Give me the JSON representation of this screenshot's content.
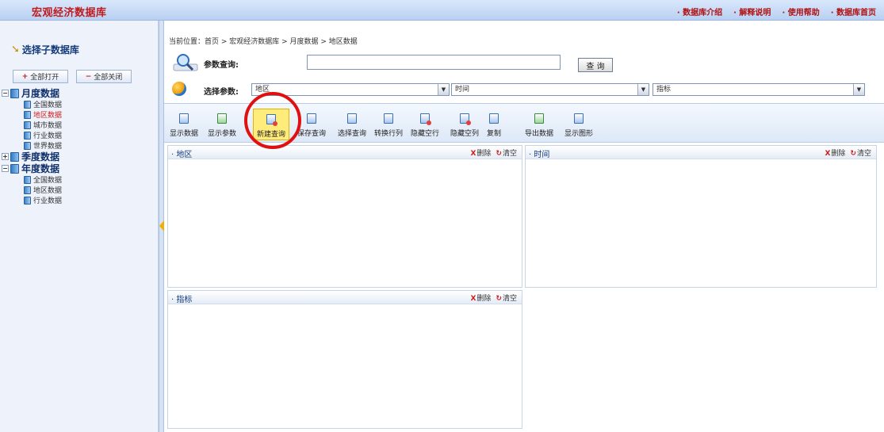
{
  "header": {
    "app_title": "宏观经济数据库",
    "links": [
      "· 数据库介绍",
      "· 解释说明",
      "· 使用帮助",
      "· 数据库首页"
    ]
  },
  "sidebar": {
    "title": "选择子数据库",
    "expand_all": "全部打开",
    "collapse_all": "全部关闭",
    "tree": [
      {
        "label": "月度数据",
        "children": [
          "全国数据",
          "地区数据",
          "城市数据",
          "行业数据",
          "世界数据"
        ]
      },
      {
        "label": "季度数据",
        "children": []
      },
      {
        "label": "年度数据",
        "children": [
          "全国数据",
          "地区数据",
          "行业数据"
        ]
      }
    ]
  },
  "main": {
    "breadcrumb": "当前位置：首页 > 宏观经济数据库 > 月度数据 > 地区数据",
    "search": {
      "label": "参数查询:",
      "value": "",
      "button": "查 询"
    },
    "params": {
      "label": "选择参数:",
      "selects": [
        "地区",
        "时间",
        "指标"
      ]
    },
    "toolbar": [
      {
        "label": "显示数据"
      },
      {
        "label": "显示参数"
      },
      {
        "label": "新建查询"
      },
      {
        "label": "保存查询"
      },
      {
        "label": "选择查询"
      },
      {
        "label": "转换行列"
      },
      {
        "label": "隐藏空行"
      },
      {
        "label": "隐藏空列"
      },
      {
        "label": "复制"
      },
      {
        "label": "导出数据"
      },
      {
        "label": "显示图形"
      }
    ],
    "panels": [
      {
        "title": "· 地区",
        "delete": "删除",
        "clear": "清空"
      },
      {
        "title": "· 时间",
        "delete": "删除",
        "clear": "清空"
      },
      {
        "title": "· 指标",
        "delete": "删除",
        "clear": "清空"
      }
    ]
  },
  "colors": {
    "brand_red": "#c01a1a",
    "highlight_yellow": "#ffec7a",
    "annotation_circle": "#e01010",
    "link_blue": "#123a7a"
  }
}
